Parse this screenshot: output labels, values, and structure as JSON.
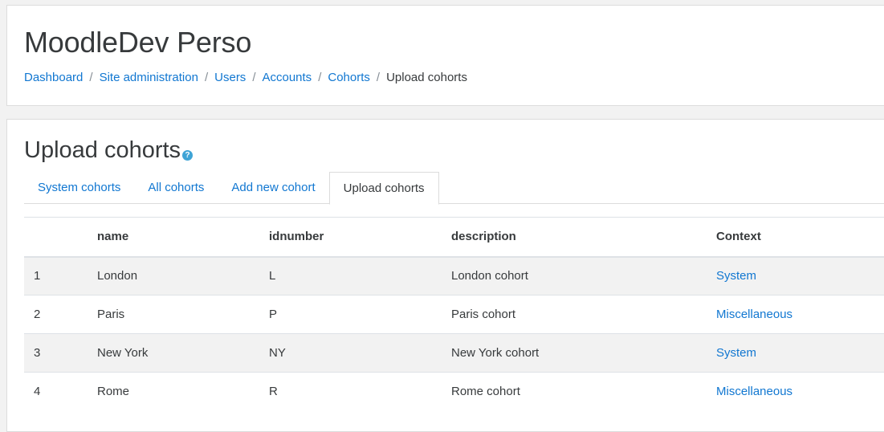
{
  "header": {
    "site_title": "MoodleDev Perso",
    "breadcrumb": [
      {
        "label": "Dashboard"
      },
      {
        "label": "Site administration"
      },
      {
        "label": "Users"
      },
      {
        "label": "Accounts"
      },
      {
        "label": "Cohorts"
      }
    ],
    "breadcrumb_current": "Upload cohorts",
    "separator": "/"
  },
  "main": {
    "heading": "Upload cohorts",
    "help_icon": "question-circle-icon",
    "tabs": [
      {
        "label": "System cohorts",
        "active": false
      },
      {
        "label": "All cohorts",
        "active": false
      },
      {
        "label": "Add new cohort",
        "active": false
      },
      {
        "label": "Upload cohorts",
        "active": true
      }
    ],
    "table": {
      "columns": [
        "",
        "name",
        "idnumber",
        "description",
        "Context"
      ],
      "rows": [
        {
          "num": "1",
          "name": "London",
          "idnumber": "L",
          "description": "London cohort",
          "context": "System"
        },
        {
          "num": "2",
          "name": "Paris",
          "idnumber": "P",
          "description": "Paris cohort",
          "context": "Miscellaneous"
        },
        {
          "num": "3",
          "name": "New York",
          "idnumber": "NY",
          "description": "New York cohort",
          "context": "System"
        },
        {
          "num": "4",
          "name": "Rome",
          "idnumber": "R",
          "description": "Rome cohort",
          "context": "Miscellaneous"
        }
      ]
    }
  },
  "colors": {
    "link": "#1177d1",
    "text": "#373a3c",
    "help_icon": "#3fa4d6",
    "stripe": "#f2f2f2"
  }
}
